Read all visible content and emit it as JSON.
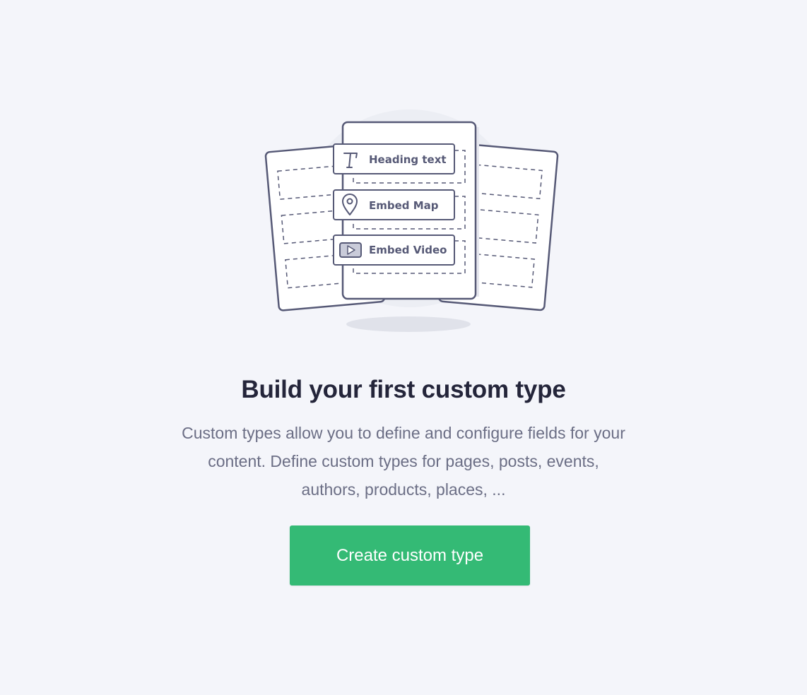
{
  "empty_state": {
    "title": "Build your first custom type",
    "description": "Custom types allow you to define and configure fields for your content. Define custom types for pages, posts, events, authors, products, places, ...",
    "button_label": "Create custom type"
  },
  "illustration": {
    "fields": [
      {
        "label": "Heading text",
        "icon": "text-t-icon"
      },
      {
        "label": "Embed Map",
        "icon": "map-pin-icon"
      },
      {
        "label": "Embed Video",
        "icon": "play-video-icon"
      }
    ]
  },
  "colors": {
    "background": "#f4f5fa",
    "accent": "#34ba75",
    "outline": "#565976",
    "title": "#24253a",
    "body_text": "#6b6e85"
  }
}
